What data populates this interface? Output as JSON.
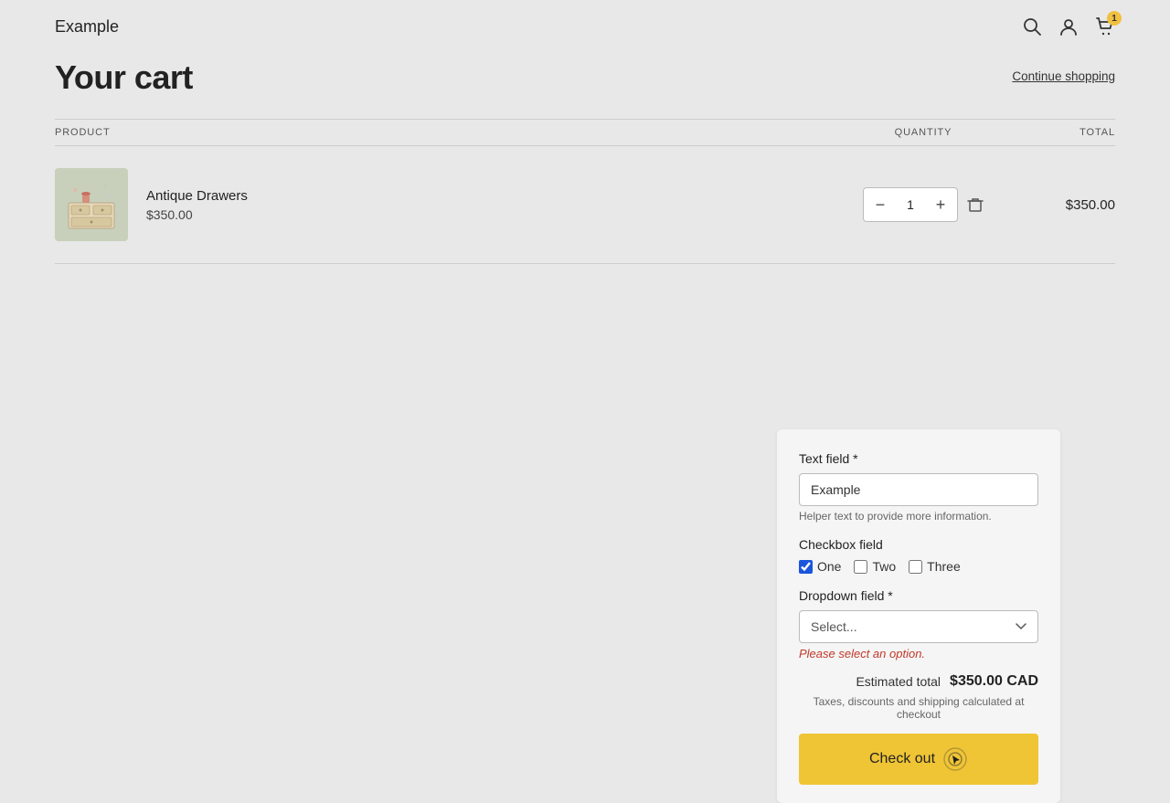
{
  "header": {
    "logo": "Example",
    "icons": {
      "search": "🔍",
      "user": "👤",
      "cart": "🛍"
    },
    "cart_count": "1"
  },
  "page": {
    "title": "Your cart",
    "continue_shopping": "Continue shopping"
  },
  "table": {
    "col_product": "PRODUCT",
    "col_quantity": "QUANTITY",
    "col_total": "TOTAL"
  },
  "cart_item": {
    "name": "Antique Drawers",
    "price": "$350.00",
    "quantity": "1",
    "total": "$350.00"
  },
  "order_summary": {
    "text_field_label": "Text field *",
    "text_field_placeholder": "Example",
    "text_field_helper": "Helper text to provide more information.",
    "checkbox_field_label": "Checkbox field",
    "checkbox_options": [
      {
        "label": "One",
        "checked": true
      },
      {
        "label": "Two",
        "checked": false
      },
      {
        "label": "Three",
        "checked": false
      }
    ],
    "dropdown_field_label": "Dropdown field *",
    "dropdown_placeholder": "Select...",
    "dropdown_error": "Please select an option.",
    "estimated_label": "Estimated total",
    "estimated_value": "$350.00 CAD",
    "taxes_text": "Taxes, discounts and shipping calculated at checkout",
    "checkout_button": "Check out"
  }
}
